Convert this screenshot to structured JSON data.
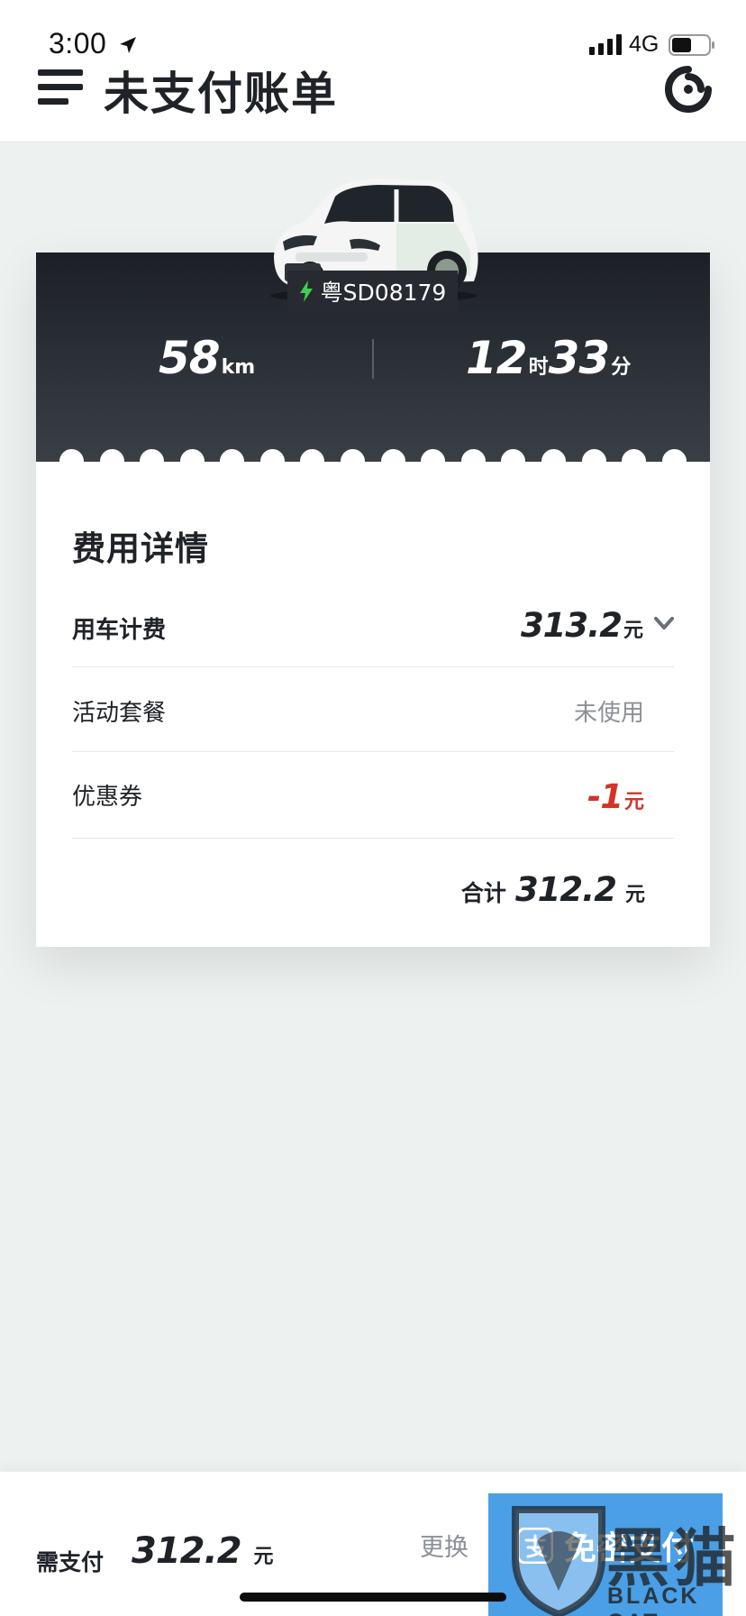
{
  "status_bar": {
    "time": "3:00",
    "network": "4G"
  },
  "header": {
    "title": "未支付账单"
  },
  "trip": {
    "plate": "粤SD08179",
    "distance_value": "58",
    "distance_unit": "km",
    "hours_value": "12",
    "hours_unit": "时",
    "minutes_value": "33",
    "minutes_unit": "分"
  },
  "fees": {
    "section_title": "费用详情",
    "usage_label": "用车计费",
    "usage_amount": "313.2",
    "currency": "元",
    "package_label": "活动套餐",
    "package_value": "未使用",
    "coupon_label": "优惠券",
    "coupon_amount": "-1",
    "total_label": "合计",
    "total_amount": "312.2"
  },
  "bottom": {
    "due_label": "需支付",
    "due_amount": "312.2",
    "change_label": "更换",
    "pay_button_label": "免密支付"
  },
  "watermark": {
    "cn": "黑猫",
    "en": "BLACK CAT"
  },
  "colors": {
    "accent_blue": "#4a9fe6",
    "discount_red": "#d43326",
    "charging_green": "#3fcf4f"
  }
}
